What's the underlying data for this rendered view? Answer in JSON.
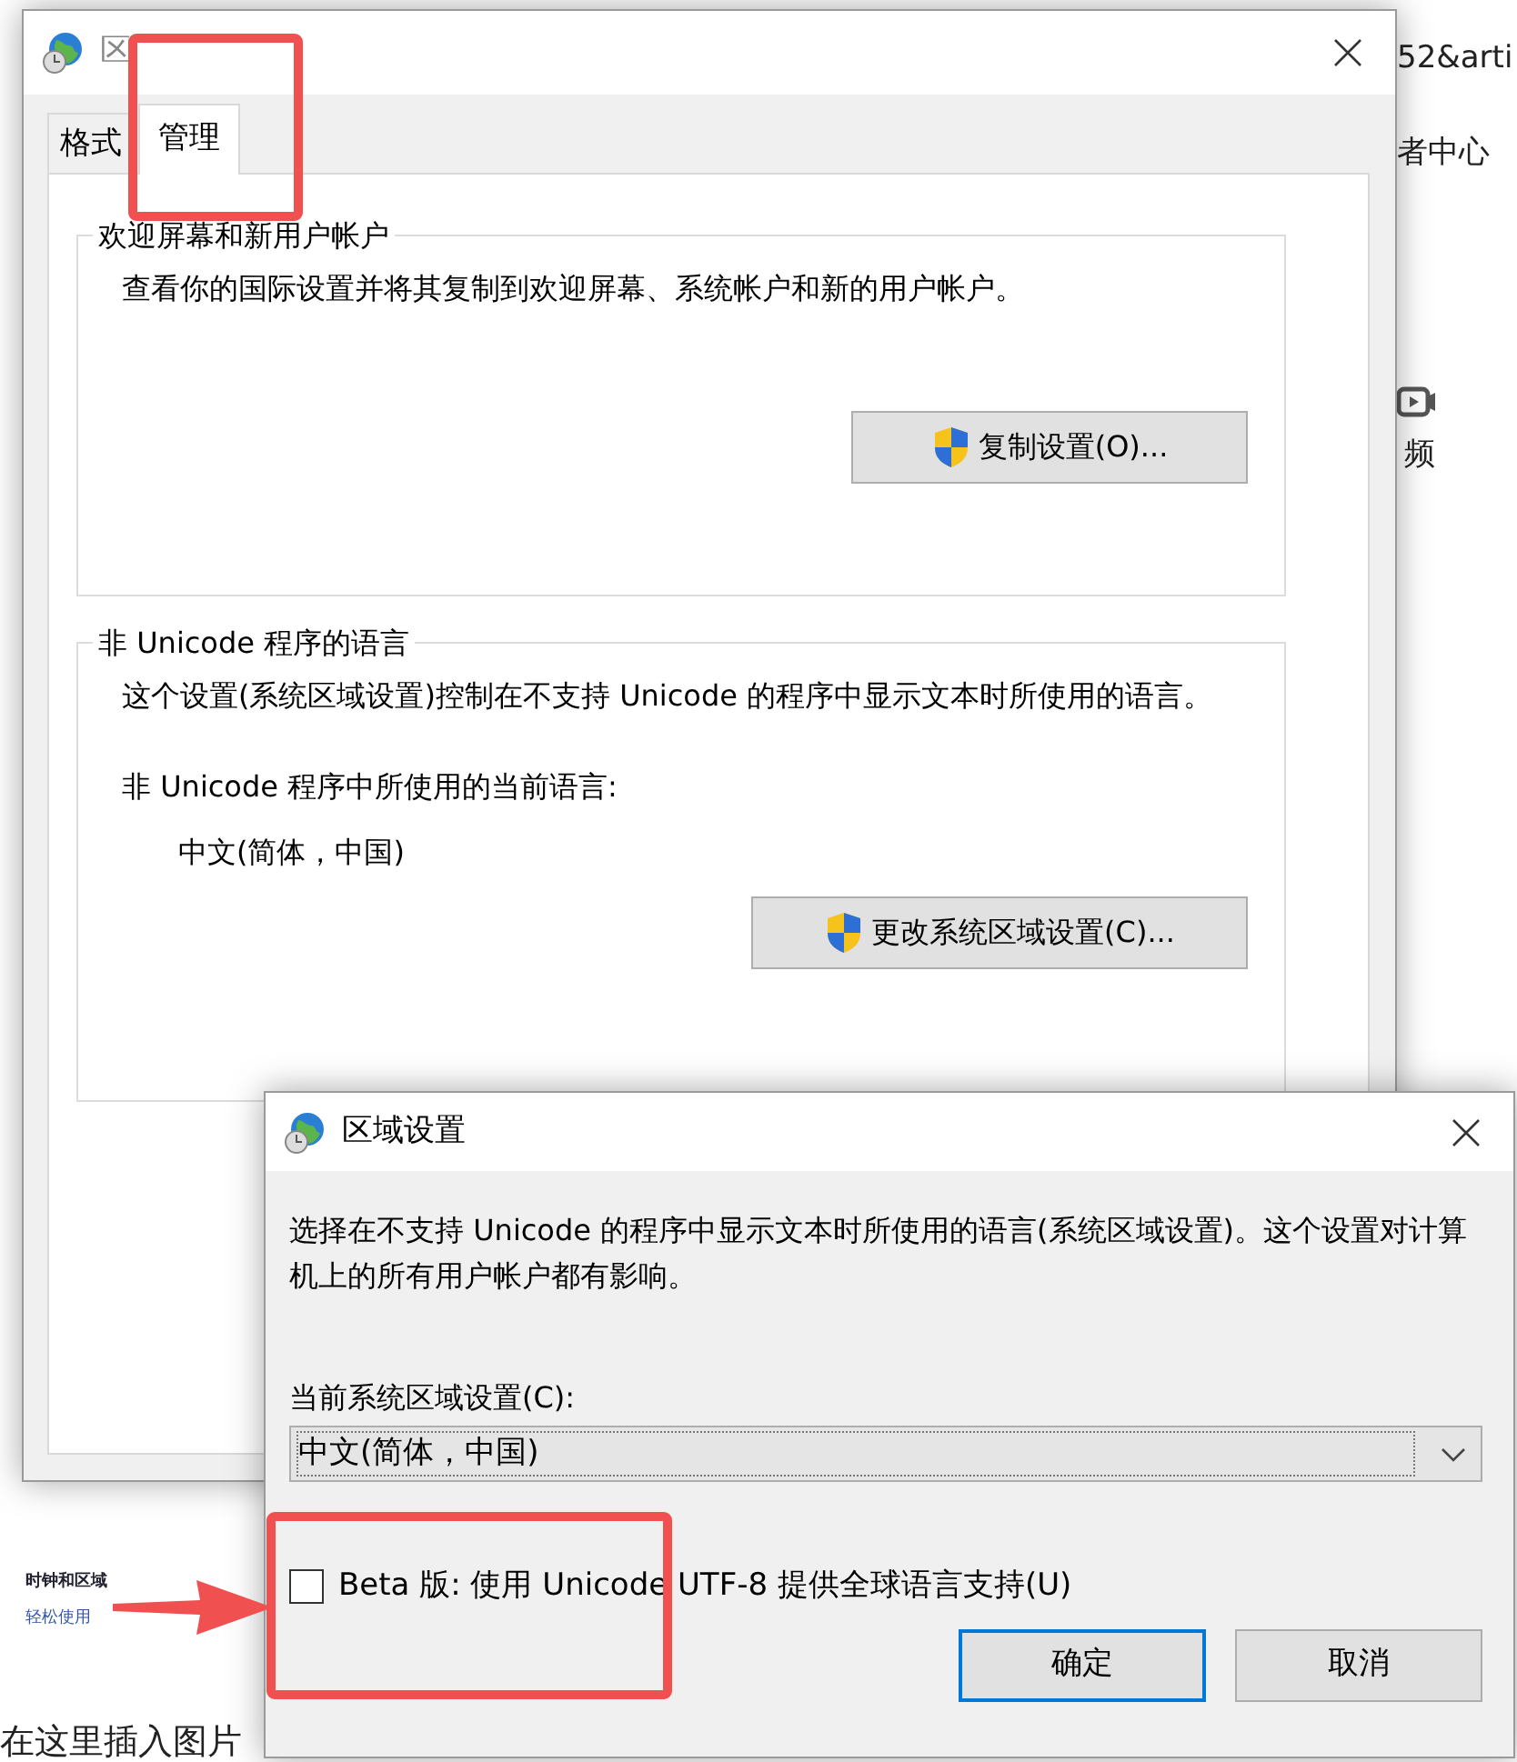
{
  "background_page": {
    "address_fragment": "52&arti",
    "nav_item": "者中心",
    "video_label": "频",
    "sidebar_items": [
      "时钟和区域",
      "轻松使用"
    ],
    "editor_text": "在这里插入图片"
  },
  "region_window": {
    "title": "区",
    "tabs": [
      {
        "label": "格式",
        "selected": false
      },
      {
        "label": "管理",
        "selected": true
      }
    ],
    "groups": [
      {
        "title": "欢迎屏幕和新用户帐户",
        "text": "查看你的国际设置并将其复制到欢迎屏幕、系统帐户和新的用户帐户。",
        "button": "复制设置(O)..."
      },
      {
        "title": "非 Unicode 程序的语言",
        "text": "这个设置(系统区域设置)控制在不支持 Unicode 的程序中显示文本时所使用的语言。",
        "current_label": "非 Unicode 程序中所使用的当前语言:",
        "current_value": "中文(简体，中国)",
        "button": "更改系统区域设置(C)..."
      }
    ]
  },
  "locale_dialog": {
    "title": "区域设置",
    "description": "选择在不支持 Unicode 的程序中显示文本时所使用的语言(系统区域设置)。这个设置对计算机上的所有用户帐户都有影响。",
    "field_label": "当前系统区域设置(C):",
    "value": "中文(简体，中国)",
    "checkbox": {
      "label": "Beta 版: 使用 Unicode UTF-8 提供全球语言支持(U)",
      "checked": false
    },
    "buttons": [
      {
        "label": "确定",
        "default": true
      },
      {
        "label": "取消",
        "default": false
      }
    ]
  }
}
